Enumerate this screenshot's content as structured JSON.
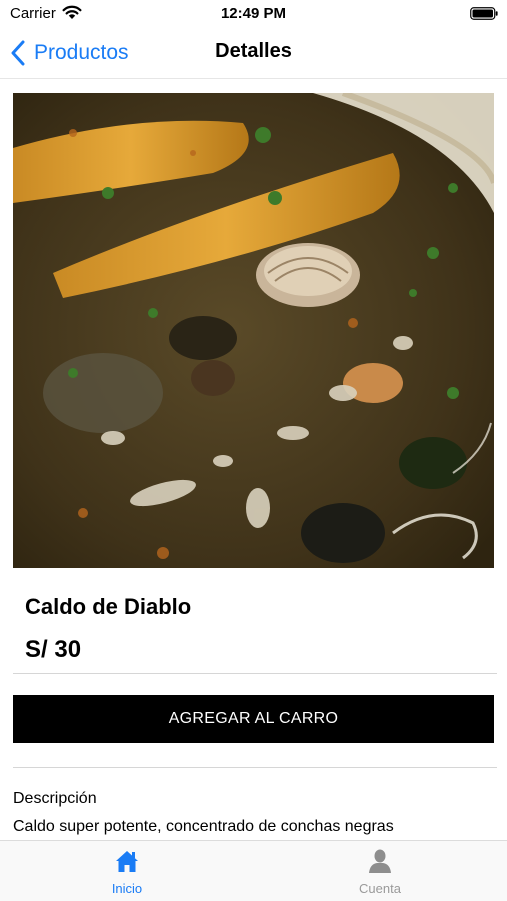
{
  "status_bar": {
    "carrier": "Carrier",
    "time": "12:49 PM"
  },
  "nav": {
    "back_label": "Productos",
    "title": "Detalles"
  },
  "product": {
    "name": "Caldo de Diablo",
    "price": "S/ 30",
    "add_to_cart_label": "AGREGAR AL CARRO",
    "description_title": "Descripción",
    "description": "Caldo super potente, concentrado de conchas negras"
  },
  "tabs": [
    {
      "label": "Inicio",
      "icon": "home-icon",
      "active": true
    },
    {
      "label": "Cuenta",
      "icon": "person-icon",
      "active": false
    }
  ],
  "colors": {
    "accent": "#1a7cf5",
    "inactive_tab": "#9a9a9a",
    "button_bg": "#000000"
  }
}
